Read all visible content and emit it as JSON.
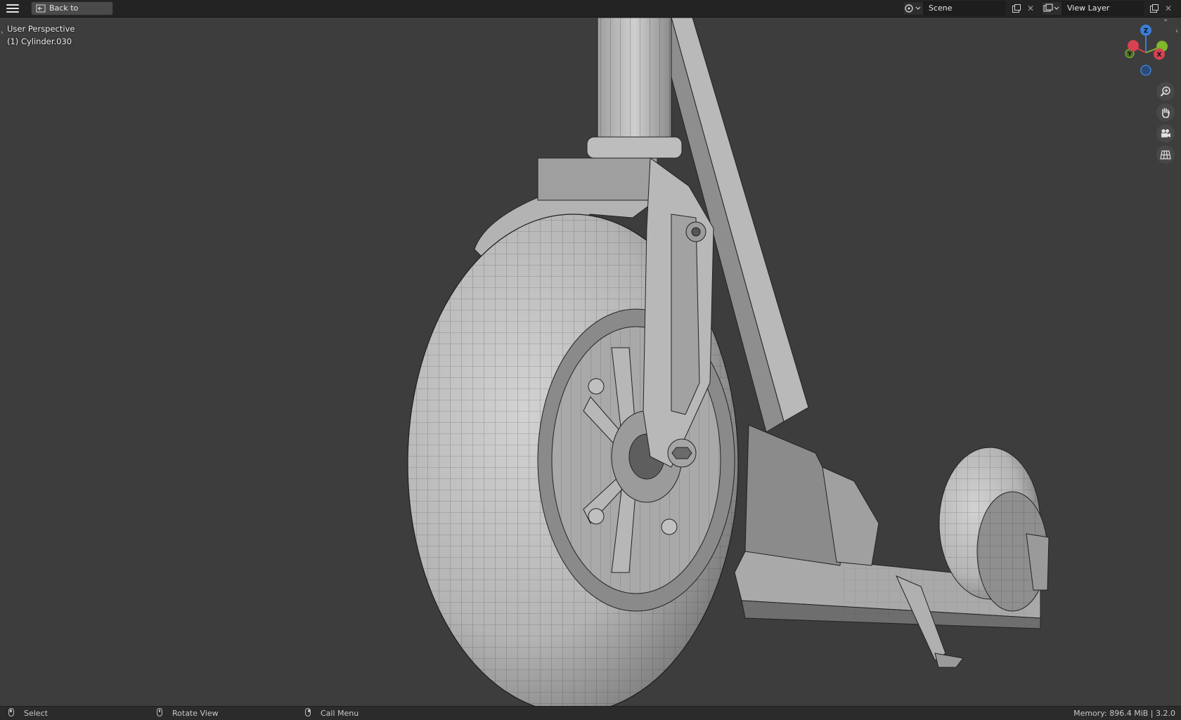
{
  "topbar": {
    "back_label": "Back to Previous",
    "scene_name": "Scene",
    "view_layer_name": "View Layer"
  },
  "viewport": {
    "view_label": "User Perspective",
    "object_label": "(1) Cylinder.030",
    "gizmo": {
      "x": "X",
      "y": "Y",
      "z": "Z"
    }
  },
  "statusbar": {
    "select": "Select",
    "rotate": "Rotate View",
    "call_menu": "Call Menu",
    "memory": "Memory: 896.4 MiB | 3.2.0"
  },
  "icons": {
    "menu": "hamburger-icon",
    "back": "back-arrow-icon",
    "scene": "scene-icon",
    "view_layer": "view-layer-icon",
    "zoom": "zoom-icon",
    "pan": "hand-icon",
    "camera": "camera-icon",
    "ortho": "grid-icon"
  },
  "colors": {
    "axis_x": "#d64153",
    "axis_y": "#7fb82a",
    "axis_z": "#3a7fd6",
    "background": "#3d3d3d"
  }
}
